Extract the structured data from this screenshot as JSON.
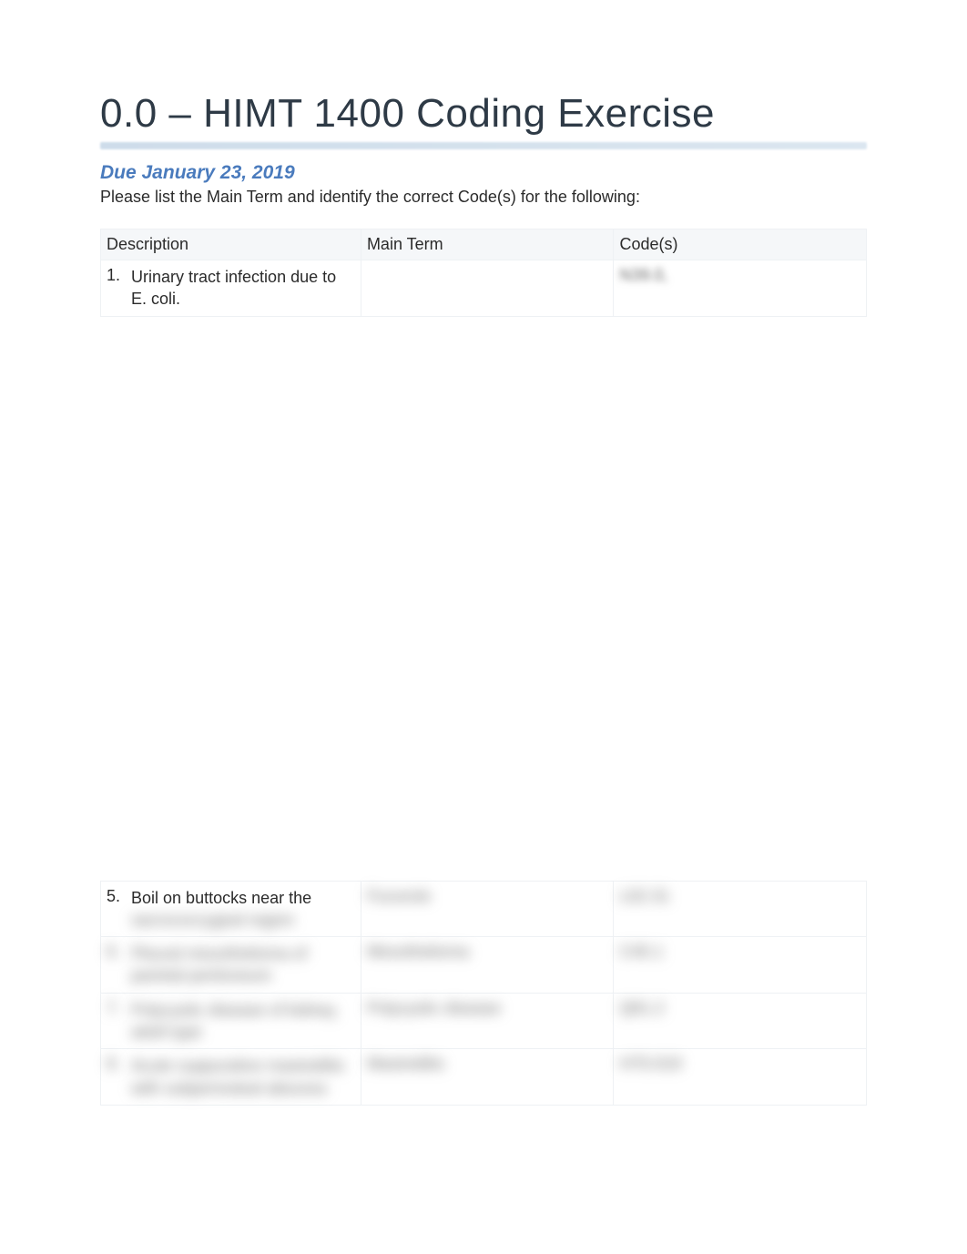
{
  "title": "0.0 – HIMT 1400 Coding Exercise",
  "due": "Due January 23, 2019",
  "instructions": "Please list the Main Term and identify the correct Code(s) for the following:",
  "headers": {
    "description": "Description",
    "main_term": "Main Term",
    "codes": "Code(s)"
  },
  "rows": [
    {
      "num": "1.",
      "description": "Urinary tract infection due to E. coli.",
      "main_term": "",
      "codes": "N39.0,",
      "desc_blurred": false,
      "answers_blurred": true
    },
    {
      "num": "5.",
      "description_visible": "Boil on buttocks near the",
      "description_hidden": "sacrococcygeal region",
      "main_term": "Furuncle",
      "codes": "L02.31",
      "desc_blurred": true,
      "answers_blurred": true
    },
    {
      "num": "6.",
      "description": "Pleural mesothelioma of parietal peritoneum",
      "main_term": "Mesothelioma",
      "codes": "C45.1",
      "desc_blurred": true,
      "answers_blurred": true
    },
    {
      "num": "7.",
      "description": "Polycystic disease of kidney, adult type",
      "main_term": "Polycystic disease",
      "codes": "Q61.2",
      "desc_blurred": true,
      "answers_blurred": true
    },
    {
      "num": "8.",
      "description": "Acute suppurative mastoiditis with subperiosteal abscess",
      "main_term": "Mastoiditis",
      "codes": "H70.019",
      "desc_blurred": true,
      "answers_blurred": true
    }
  ]
}
